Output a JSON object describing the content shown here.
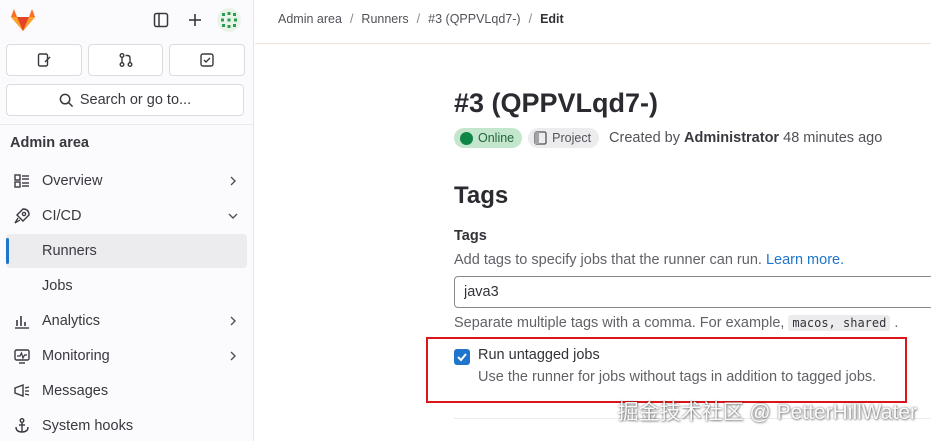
{
  "sidebar": {
    "search_label": "Search or go to...",
    "section_title": "Admin area",
    "items": [
      {
        "label": "Overview",
        "icon": "overview-icon",
        "chevron": "right"
      },
      {
        "label": "CI/CD",
        "icon": "rocket-icon",
        "chevron": "down"
      },
      {
        "label": "Runners",
        "active": true
      },
      {
        "label": "Jobs"
      },
      {
        "label": "Analytics",
        "icon": "chart-icon",
        "chevron": "right"
      },
      {
        "label": "Monitoring",
        "icon": "monitor-icon",
        "chevron": "right"
      },
      {
        "label": "Messages",
        "icon": "messages-icon"
      },
      {
        "label": "System hooks",
        "icon": "hook-icon"
      }
    ]
  },
  "breadcrumb": {
    "items": [
      "Admin area",
      "Runners",
      "#3 (QPPVLqd7-)",
      "Edit"
    ]
  },
  "runner": {
    "title": "#3 (QPPVLqd7-)",
    "status": "Online",
    "type": "Project",
    "created_prefix": "Created by",
    "created_by": "Administrator",
    "created_ago": "48 minutes ago"
  },
  "tags_section": {
    "heading": "Tags",
    "field_label": "Tags",
    "help_text": "Add tags to specify jobs that the runner can run.",
    "learn_more": "Learn more.",
    "input_value": "java3",
    "separator_help": "Separate multiple tags with a comma. For example,",
    "example_code": "macos, shared",
    "separator_end": "."
  },
  "untagged": {
    "checked": true,
    "label": "Run untagged jobs",
    "help": "Use the runner for jobs without tags in addition to tagged jobs."
  },
  "watermark": "掘金技术社区 @ PetterHillWater",
  "colors": {
    "accent": "#1f75cb",
    "online_badge": "#c3e6cd",
    "online_dot": "#108548",
    "highlight_border": "#d9161b"
  }
}
